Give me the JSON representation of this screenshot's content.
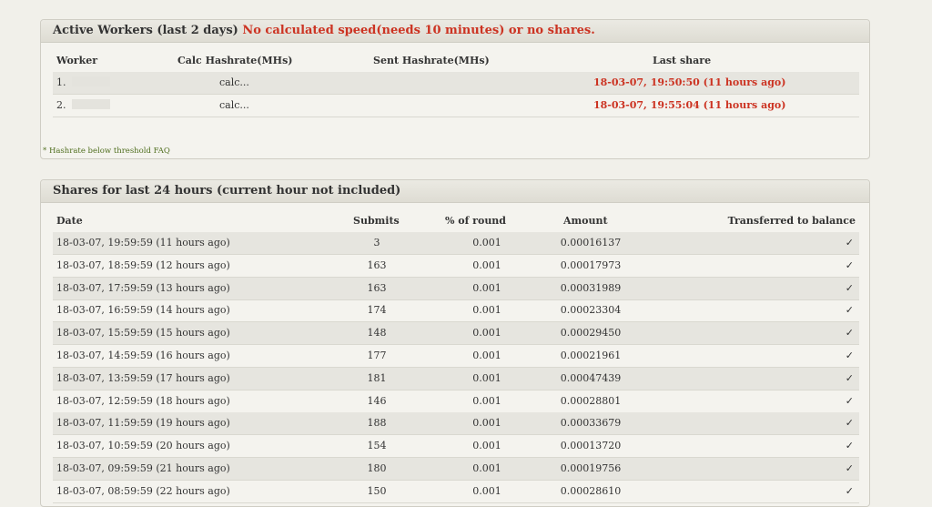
{
  "workers_panel": {
    "title": "Active Workers (last 2 days)",
    "warning": "No calculated speed(needs 10 minutes) or no shares.",
    "columns": [
      "Worker",
      "Calc Hashrate(MHs)",
      "Sent Hashrate(MHs)",
      "Last share"
    ],
    "rows": [
      {
        "worker": "1.",
        "calc": "calc...",
        "sent": "",
        "last_share": "18-03-07, 19:50:50 (11 hours ago)"
      },
      {
        "worker": "2.",
        "calc": "calc...",
        "sent": "",
        "last_share": "18-03-07, 19:55:04 (11 hours ago)"
      }
    ],
    "footnote_prefix": "* ",
    "footnote_link": "Hashrate below threshold FAQ"
  },
  "shares_panel": {
    "title": "Shares for last 24 hours (current hour not included)",
    "columns": [
      "Date",
      "Submits",
      "% of round",
      "Amount",
      "Transferred to balance"
    ],
    "rows": [
      {
        "date": "18-03-07, 19:59:59 (11 hours ago)",
        "submits": "3",
        "pct": "0.001",
        "amount": "0.00016137",
        "transferred": "✓"
      },
      {
        "date": "18-03-07, 18:59:59 (12 hours ago)",
        "submits": "163",
        "pct": "0.001",
        "amount": "0.00017973",
        "transferred": "✓"
      },
      {
        "date": "18-03-07, 17:59:59 (13 hours ago)",
        "submits": "163",
        "pct": "0.001",
        "amount": "0.00031989",
        "transferred": "✓"
      },
      {
        "date": "18-03-07, 16:59:59 (14 hours ago)",
        "submits": "174",
        "pct": "0.001",
        "amount": "0.00023304",
        "transferred": "✓"
      },
      {
        "date": "18-03-07, 15:59:59 (15 hours ago)",
        "submits": "148",
        "pct": "0.001",
        "amount": "0.00029450",
        "transferred": "✓"
      },
      {
        "date": "18-03-07, 14:59:59 (16 hours ago)",
        "submits": "177",
        "pct": "0.001",
        "amount": "0.00021961",
        "transferred": "✓"
      },
      {
        "date": "18-03-07, 13:59:59 (17 hours ago)",
        "submits": "181",
        "pct": "0.001",
        "amount": "0.00047439",
        "transferred": "✓"
      },
      {
        "date": "18-03-07, 12:59:59 (18 hours ago)",
        "submits": "146",
        "pct": "0.001",
        "amount": "0.00028801",
        "transferred": "✓"
      },
      {
        "date": "18-03-07, 11:59:59 (19 hours ago)",
        "submits": "188",
        "pct": "0.001",
        "amount": "0.00033679",
        "transferred": "✓"
      },
      {
        "date": "18-03-07, 10:59:59 (20 hours ago)",
        "submits": "154",
        "pct": "0.001",
        "amount": "0.00013720",
        "transferred": "✓"
      },
      {
        "date": "18-03-07, 09:59:59 (21 hours ago)",
        "submits": "180",
        "pct": "0.001",
        "amount": "0.00019756",
        "transferred": "✓"
      },
      {
        "date": "18-03-07, 08:59:59 (22 hours ago)",
        "submits": "150",
        "pct": "0.001",
        "amount": "0.00028610",
        "transferred": "✓"
      }
    ]
  },
  "colors": {
    "warning": "#cc3322",
    "link": "#4f6e1e",
    "background": "#f1f0ea"
  }
}
